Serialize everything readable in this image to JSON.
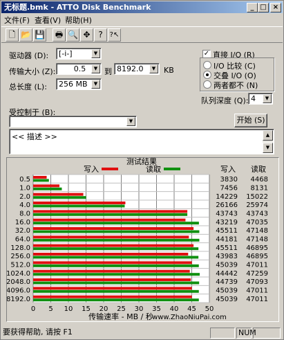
{
  "window": {
    "title": "无标题.bmk - ATTO Disk Benchmark"
  },
  "titlebar_buttons": {
    "minimize": "_",
    "maximize": "□",
    "close": "×"
  },
  "menu": {
    "file": "文件(F)",
    "view": "查看(V)",
    "help": "帮助(H)"
  },
  "toolbar": {
    "icons": [
      "new-icon",
      "open-icon",
      "save-icon",
      "print-icon",
      "print-preview-icon",
      "move-icon",
      "help-icon",
      "context-help-icon"
    ],
    "glyphs": {
      "new": "🗋",
      "open": "📂",
      "save": "💾",
      "print": "🖶",
      "preview": "🔍",
      "move": "✥",
      "help": "?",
      "context_help": "?↖"
    }
  },
  "settings": {
    "drive_label": "驱动器 (D):",
    "drive_value": "[-i-]",
    "transfer_label": "传输大小 (Z):",
    "transfer_from": "0.5",
    "transfer_to_label": "到",
    "transfer_to": "8192.0",
    "transfer_unit": "KB",
    "total_length_label": "总长度 (L):",
    "total_length_value": "256 MB",
    "controlled_by_label": "受控制于 (B):",
    "controlled_by_value": "",
    "direct_io_label": "直接 I/O (R)",
    "direct_io_checked": true,
    "io_compare_label": "I/O 比较 (C)",
    "overlapped_io_label": "交叠 I/O (O)",
    "neither_label": "两者都不 (N)",
    "selected_mode": "overlapped",
    "queue_depth_label": "队列深度 (Q):",
    "queue_depth_value": "4",
    "start_button": "开始 (S)",
    "description": "<< 描述 >>"
  },
  "results": {
    "title": "测试结果",
    "write_legend": "写入",
    "read_legend": "读取",
    "write_col": "写入",
    "read_col": "读取",
    "write_color": "#e01010",
    "read_color": "#109010",
    "rows": [
      {
        "size": "0.5",
        "write": "3830",
        "read": "4468"
      },
      {
        "size": "1.0",
        "write": "7456",
        "read": "8131"
      },
      {
        "size": "2.0",
        "write": "14229",
        "read": "15022"
      },
      {
        "size": "4.0",
        "write": "26166",
        "read": "25974"
      },
      {
        "size": "8.0",
        "write": "43743",
        "read": "43743"
      },
      {
        "size": "16.0",
        "write": "43219",
        "read": "47035"
      },
      {
        "size": "32.0",
        "write": "45511",
        "read": "47148"
      },
      {
        "size": "64.0",
        "write": "44181",
        "read": "47148"
      },
      {
        "size": "128.0",
        "write": "45511",
        "read": "46895"
      },
      {
        "size": "256.0",
        "write": "43983",
        "read": "46895"
      },
      {
        "size": "512.0",
        "write": "45039",
        "read": "47011"
      },
      {
        "size": "1024.0",
        "write": "44442",
        "read": "47259"
      },
      {
        "size": "2048.0",
        "write": "44739",
        "read": "47093"
      },
      {
        "size": "4096.0",
        "write": "45039",
        "read": "47011"
      },
      {
        "size": "8192.0",
        "write": "45039",
        "read": "47011"
      }
    ],
    "xticks": [
      "0",
      "5",
      "10",
      "15",
      "20",
      "25",
      "30",
      "35",
      "40",
      "45",
      "50"
    ],
    "xlabel": "传输速率 - MB / 秒",
    "watermark": "www.ZhaoNiuPai.com"
  },
  "chart_data": {
    "type": "bar",
    "title": "测试结果",
    "xlabel": "传输速率 - MB / 秒",
    "xlim": [
      0,
      50
    ],
    "categories": [
      "0.5",
      "1.0",
      "2.0",
      "4.0",
      "8.0",
      "16.0",
      "32.0",
      "64.0",
      "128.0",
      "256.0",
      "512.0",
      "1024.0",
      "2048.0",
      "4096.0",
      "8192.0"
    ],
    "series": [
      {
        "name": "写入",
        "values": [
          3.83,
          7.456,
          14.229,
          26.166,
          43.743,
          43.219,
          45.511,
          44.181,
          45.511,
          43.983,
          45.039,
          44.442,
          44.739,
          45.039,
          45.039
        ]
      },
      {
        "name": "读取",
        "values": [
          4.468,
          8.131,
          15.022,
          25.974,
          43.743,
          47.035,
          47.148,
          47.148,
          46.895,
          46.895,
          47.011,
          47.259,
          47.093,
          47.011,
          47.011
        ]
      }
    ],
    "grid": true,
    "legend": "top"
  },
  "status": {
    "help_text": "要获得帮助, 请按 F1",
    "num": "NUM"
  }
}
